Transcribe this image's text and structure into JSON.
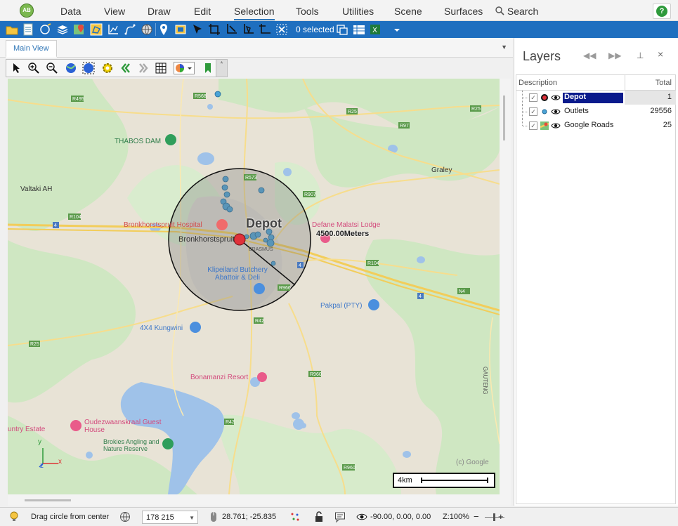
{
  "menu": {
    "items": [
      "Data",
      "View",
      "Draw",
      "Edit",
      "Selection",
      "Tools",
      "Utilities",
      "Scene",
      "Surfaces"
    ],
    "active": "Selection",
    "search_label": "Search",
    "help_label": "?"
  },
  "toolbar": {
    "selected_count": "0 selected",
    "accent": "#1f6fbf"
  },
  "main": {
    "tab_label": "Main View",
    "map_toolbar_more": "*"
  },
  "map": {
    "circle_label": "Depot",
    "radius_label": "4500.00Meters",
    "scale_label": "4km",
    "axis": {
      "y": "y",
      "x": "x",
      "z": "z"
    },
    "watermark": "(c) Google",
    "places": [
      {
        "id": "thabos-dam",
        "text": "THABOS DAM",
        "kind": "park"
      },
      {
        "id": "valtaki",
        "text": "Valtaki AH",
        "kind": "town"
      },
      {
        "id": "graley",
        "text": "Graley",
        "kind": "town"
      },
      {
        "id": "hospital",
        "text": "Bronkhorstspruit Hospital",
        "kind": "poi-red"
      },
      {
        "id": "bronkhorst",
        "text": "Bronkhorstspruit",
        "kind": "town"
      },
      {
        "id": "erasmus",
        "text": "ERASMUS",
        "kind": "small"
      },
      {
        "id": "defane",
        "text": "Defane Malatsi Lodge",
        "kind": "poi-red"
      },
      {
        "id": "klipeiland",
        "text": "Klipeiland Butchery Abattoir & Deli",
        "kind": "poi-blue"
      },
      {
        "id": "pakpal",
        "text": "Pakpal (PTY)",
        "kind": "poi-blue"
      },
      {
        "id": "kungwini",
        "text": "4X4 Kungwini",
        "kind": "poi-blue"
      },
      {
        "id": "bonamanzi",
        "text": "Bonamanzi Resort",
        "kind": "poi-red"
      },
      {
        "id": "oudezwaanskraal",
        "text": "Oudezwaanskraal Guest House",
        "kind": "poi-red"
      },
      {
        "id": "country-estate",
        "text": "untry Estate",
        "kind": "poi-red"
      },
      {
        "id": "brokkies",
        "text": "Brokies Angling and Nature Reserve",
        "kind": "park"
      },
      {
        "id": "gauteng",
        "text": "GAUTENG",
        "kind": "small"
      }
    ],
    "roads": [
      "R495",
      "R568",
      "R25",
      "R97",
      "R25",
      "R573",
      "R907",
      "R104",
      "R104",
      "R966",
      "R42",
      "R960",
      "R42",
      "R960",
      "R25",
      "4",
      "4",
      "4",
      "N4"
    ]
  },
  "layers": {
    "title": "Layers",
    "col_description": "Description",
    "col_total": "Total",
    "rows": [
      {
        "name": "Depot",
        "total": "1",
        "symbol": "depot",
        "selected": true
      },
      {
        "name": "Outlets",
        "total": "29556",
        "symbol": "outlet",
        "selected": false
      },
      {
        "name": "Google Roads",
        "total": "25",
        "symbol": "roads",
        "selected": false
      }
    ]
  },
  "status": {
    "hint": "Drag circle from center",
    "combo_value": "178 215",
    "coords": "28.761; -25.835",
    "camera": "-90.00, 0.00, 0.00",
    "zoom": "Z:100%",
    "zoom_minus": "−",
    "zoom_plus": "+"
  }
}
